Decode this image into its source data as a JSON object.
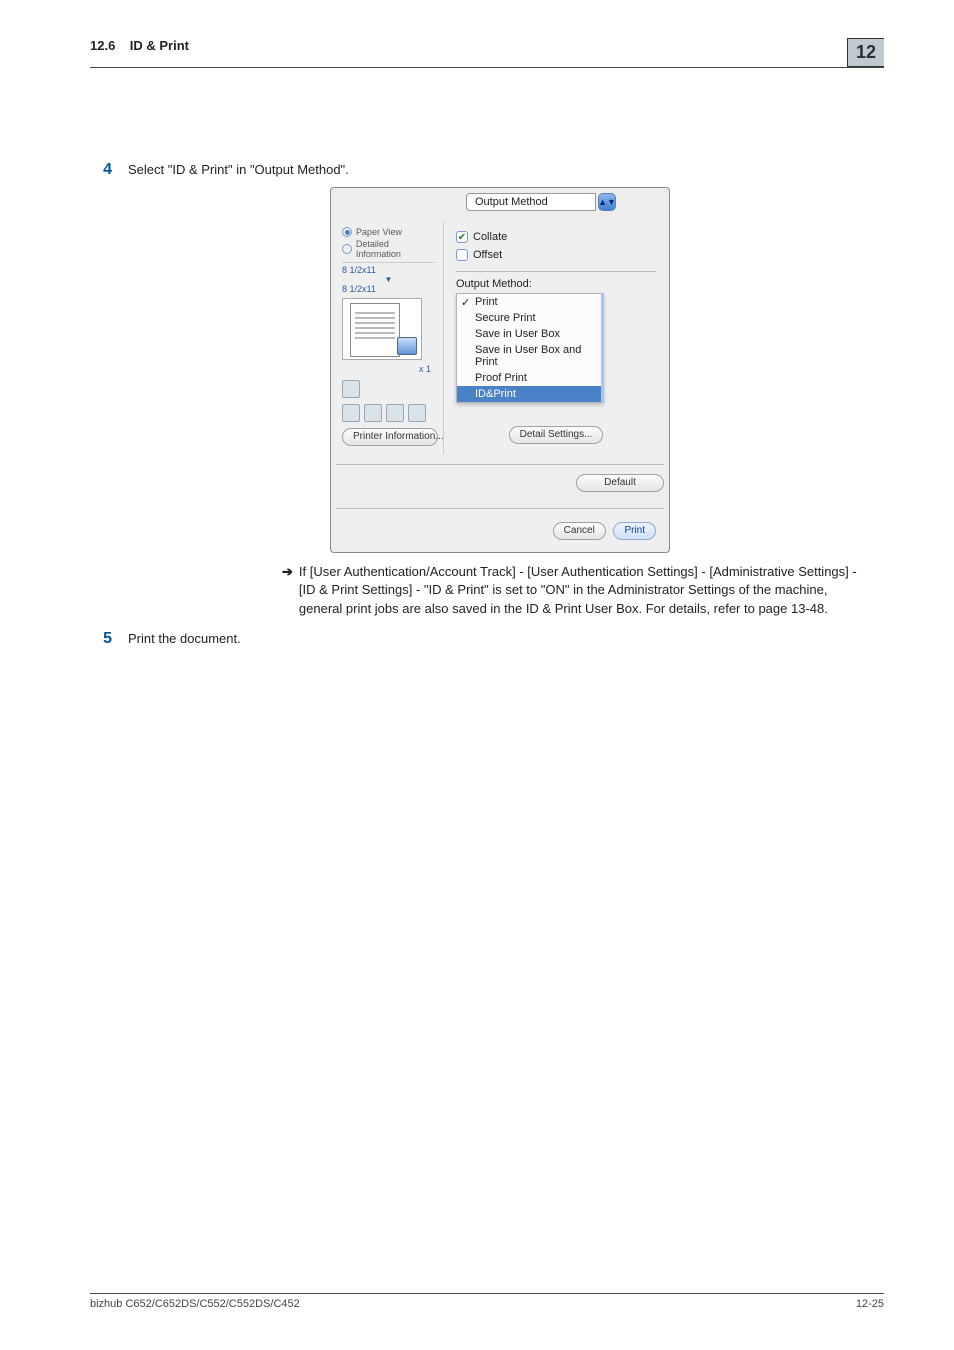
{
  "header": {
    "section_no": "12.6",
    "section_title": "ID & Print",
    "chapter_no": "12"
  },
  "step4": {
    "number": "4",
    "text": "Select \"ID & Print\" in \"Output Method\"."
  },
  "dialog": {
    "combo_label": "Output Method",
    "left": {
      "paper_view": "Paper View",
      "detailed_info": "Detailed Information",
      "size1": "8 1/2x11",
      "size2": "8 1/2x11",
      "multiplier": "x 1",
      "printer_info_btn": "Printer Information..."
    },
    "right": {
      "collate": "Collate",
      "offset": "Offset",
      "output_method_label": "Output Method:",
      "menu": {
        "print": "Print",
        "secure": "Secure Print",
        "save_box": "Save in User Box",
        "save_box_print": "Save in User Box and Print",
        "proof": "Proof Print",
        "idprint": "ID&Print"
      },
      "detail_btn": "Detail Settings...",
      "default_btn": "Default"
    },
    "footer": {
      "cancel": "Cancel",
      "print": "Print"
    }
  },
  "note": {
    "text": "If [User Authentication/Account Track] - [User Authentication Settings] - [Administrative Settings] - [ID & Print Settings] - \"ID & Print\" is set to \"ON\" in the Administrator Settings of the machine, general print jobs are also saved in the ID & Print User Box. For details, refer to page 13-48."
  },
  "step5": {
    "number": "5",
    "text": "Print the document."
  },
  "footer": {
    "model": "bizhub C652/C652DS/C552/C552DS/C452",
    "page": "12-25"
  }
}
